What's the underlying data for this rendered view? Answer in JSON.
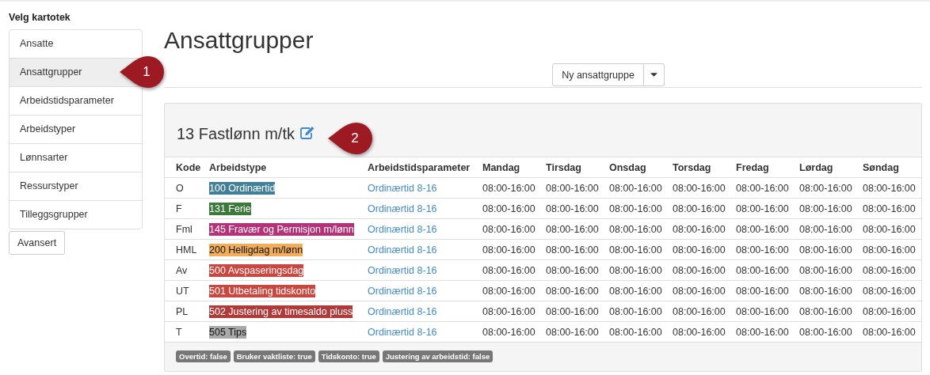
{
  "sidebar": {
    "heading": "Velg kartotek",
    "items": [
      {
        "label": "Ansatte",
        "selected": false
      },
      {
        "label": "Ansattgrupper",
        "selected": true
      },
      {
        "label": "Arbeidstidsparameter",
        "selected": false
      },
      {
        "label": "Arbeidstyper",
        "selected": false
      },
      {
        "label": "Lønnsarter",
        "selected": false
      },
      {
        "label": "Ressurstyper",
        "selected": false
      },
      {
        "label": "Tilleggsgrupper",
        "selected": false
      }
    ],
    "button": "Avansert"
  },
  "page_title": "Ansattgrupper",
  "new_button": "Ny ansattgruppe",
  "group": {
    "title": "13 Fastlønn m/tk",
    "table": {
      "columns": [
        "Kode",
        "Arbeidstype",
        "Arbeidstidsparameter",
        "Mandag",
        "Tirsdag",
        "Onsdag",
        "Torsdag",
        "Fredag",
        "Lørdag",
        "Søndag"
      ],
      "rows": [
        {
          "kode": "O",
          "arbeidstype": "100 Ordinærtid",
          "color": "#428098",
          "parameter": "Ordinærtid 8-16",
          "days": [
            "08:00-16:00",
            "08:00-16:00",
            "08:00-16:00",
            "08:00-16:00",
            "08:00-16:00",
            "08:00-16:00",
            "08:00-16:00"
          ]
        },
        {
          "kode": "F",
          "arbeidstype": "131 Ferie",
          "color": "#3b7a3b",
          "parameter": "Ordinærtid 8-16",
          "days": [
            "08:00-16:00",
            "08:00-16:00",
            "08:00-16:00",
            "08:00-16:00",
            "08:00-16:00",
            "08:00-16:00",
            "08:00-16:00"
          ]
        },
        {
          "kode": "Fml",
          "arbeidstype": "145 Fravær og Permisjon m/lønn",
          "color": "#b43378",
          "parameter": "Ordinærtid 8-16",
          "days": [
            "08:00-16:00",
            "08:00-16:00",
            "08:00-16:00",
            "08:00-16:00",
            "08:00-16:00",
            "08:00-16:00",
            "08:00-16:00"
          ]
        },
        {
          "kode": "HML",
          "arbeidstype": "200 Helligdag m/lønn",
          "color": "#f0ad5a",
          "parameter": "Ordinærtid 8-16",
          "days": [
            "08:00-16:00",
            "08:00-16:00",
            "08:00-16:00",
            "08:00-16:00",
            "08:00-16:00",
            "08:00-16:00",
            "08:00-16:00"
          ]
        },
        {
          "kode": "Av",
          "arbeidstype": "500 Avspaseringsdag",
          "color": "#c9473f",
          "parameter": "Ordinærtid 8-16",
          "days": [
            "08:00-16:00",
            "08:00-16:00",
            "08:00-16:00",
            "08:00-16:00",
            "08:00-16:00",
            "08:00-16:00",
            "08:00-16:00"
          ]
        },
        {
          "kode": "UT",
          "arbeidstype": "501 Utbetaling tidskonto",
          "color": "#c9473f",
          "parameter": "Ordinærtid 8-16",
          "days": [
            "08:00-16:00",
            "08:00-16:00",
            "08:00-16:00",
            "08:00-16:00",
            "08:00-16:00",
            "08:00-16:00",
            "08:00-16:00"
          ]
        },
        {
          "kode": "PL",
          "arbeidstype": "502 Justering av timesaldo pluss",
          "color": "#b03a3a",
          "parameter": "Ordinærtid 8-16",
          "days": [
            "08:00-16:00",
            "08:00-16:00",
            "08:00-16:00",
            "08:00-16:00",
            "08:00-16:00",
            "08:00-16:00",
            "08:00-16:00"
          ]
        },
        {
          "kode": "T",
          "arbeidstype": "505 Tips",
          "color": "#a9a9a9",
          "parameter": "Ordinærtid 8-16",
          "days": [
            "08:00-16:00",
            "08:00-16:00",
            "08:00-16:00",
            "08:00-16:00",
            "08:00-16:00",
            "08:00-16:00",
            "08:00-16:00"
          ]
        }
      ]
    },
    "badges": [
      "Overtid: false",
      "Bruker vaktliste: true",
      "Tidskonto: true",
      "Justering av arbeidstid: false"
    ]
  },
  "callouts": [
    "1",
    "2"
  ]
}
